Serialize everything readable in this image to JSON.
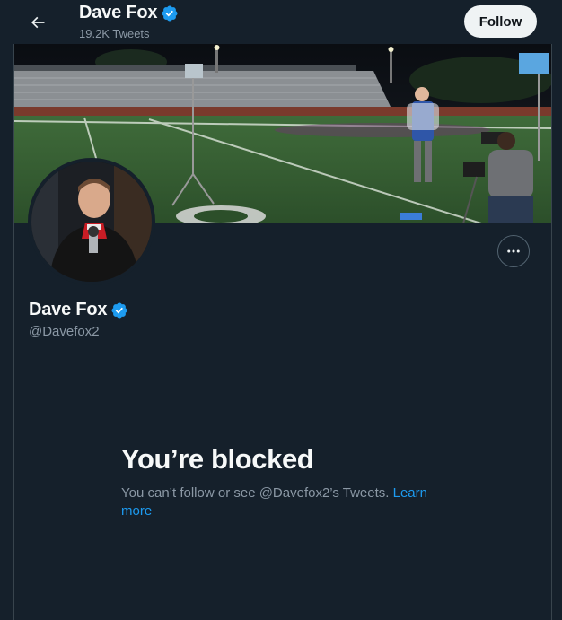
{
  "header": {
    "name": "Dave Fox",
    "tweet_count": "19.2K Tweets",
    "follow_label": "Follow"
  },
  "profile": {
    "name": "Dave Fox",
    "handle": "@Davefox2",
    "verified": true
  },
  "blocked": {
    "title": "You’re blocked",
    "message": "You can’t follow or see @Davefox2’s Tweets. ",
    "link_label": "Learn more"
  },
  "colors": {
    "background": "#15202b",
    "accent": "#1d9bf0",
    "secondary_text": "#8b98a5"
  },
  "icons": {
    "back": "arrow-left-icon",
    "verified": "verified-badge-icon",
    "more": "more-horizontal-icon"
  }
}
